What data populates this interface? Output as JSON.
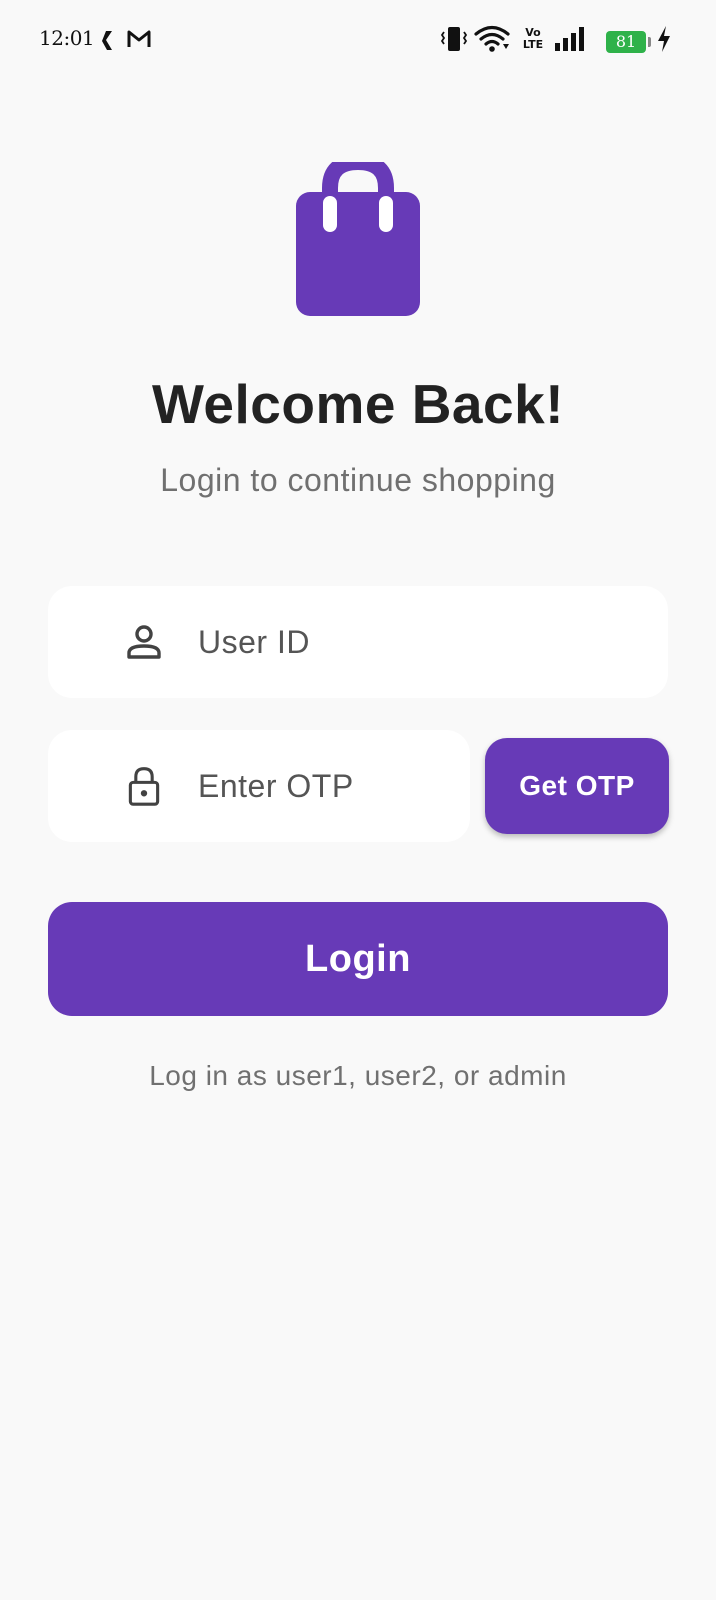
{
  "status_bar": {
    "time": "12:01",
    "battery_level": "81",
    "left_icons": [
      "kite-icon",
      "gmail-icon"
    ],
    "right_icons": [
      "vibrate-icon",
      "wifi-icon",
      "volte-icon",
      "signal-icon",
      "battery-icon",
      "charging-icon"
    ],
    "volte_label_top": "Vo",
    "volte_label_bottom": "LTE",
    "battery_color": "#2fb24a"
  },
  "header": {
    "logo_icon": "shopping-bag-icon",
    "title": "Welcome Back!",
    "subtitle": "Login to continue shopping"
  },
  "form": {
    "user_id": {
      "placeholder": "User ID",
      "value": "",
      "icon": "person-icon"
    },
    "otp": {
      "placeholder": "Enter OTP",
      "value": "",
      "icon": "lock-icon"
    },
    "get_otp_label": "Get OTP",
    "login_label": "Login",
    "hint": "Log in as user1, user2, or admin"
  },
  "colors": {
    "accent": "#673ab7",
    "background": "#f9f9f9",
    "title_text": "#222222",
    "muted_text": "#707070"
  }
}
